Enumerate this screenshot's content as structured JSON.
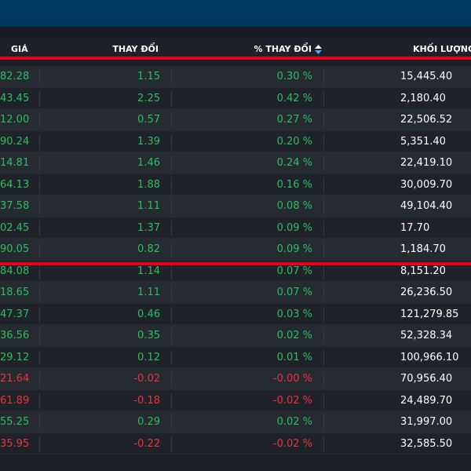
{
  "header": {
    "col_price": "GIÁ",
    "col_change": "THAY ĐỔI",
    "col_pct": "% THAY ĐỔI",
    "col_volume": "KHỐI LƯỢNG"
  },
  "colors": {
    "up": "#2dbe60",
    "down": "#e8343d",
    "highlight_line": "#e8001c",
    "topbar": "#003a63"
  },
  "sort_icon": "sort-up-down-icon",
  "rows": [
    {
      "price": "82.28",
      "change": "1.15",
      "pct": "0.30 %",
      "volume": "15,445.40",
      "dir": "up"
    },
    {
      "price": "43.45",
      "change": "2.25",
      "pct": "0.42 %",
      "volume": "2,180.40",
      "dir": "up"
    },
    {
      "price": "12.00",
      "change": "0.57",
      "pct": "0.27 %",
      "volume": "22,506.52",
      "dir": "up"
    },
    {
      "price": "90.24",
      "change": "1.39",
      "pct": "0.20 %",
      "volume": "5,351.40",
      "dir": "up"
    },
    {
      "price": "14.81",
      "change": "1.46",
      "pct": "0.24 %",
      "volume": "22,419.10",
      "dir": "up"
    },
    {
      "price": "64.13",
      "change": "1.88",
      "pct": "0.16 %",
      "volume": "30,009.70",
      "dir": "up"
    },
    {
      "price": "37.58",
      "change": "1.11",
      "pct": "0.08 %",
      "volume": "49,104.40",
      "dir": "up"
    },
    {
      "price": "02.45",
      "change": "1.37",
      "pct": "0.09 %",
      "volume": "17.70",
      "dir": "up"
    },
    {
      "price": "90.05",
      "change": "0.82",
      "pct": "0.09 %",
      "volume": "1,184.70",
      "dir": "up"
    },
    {
      "price": "84.08",
      "change": "1.14",
      "pct": "0.07 %",
      "volume": "8,151.20",
      "dir": "up"
    },
    {
      "price": "18.65",
      "change": "1.11",
      "pct": "0.07 %",
      "volume": "26,236.50",
      "dir": "up"
    },
    {
      "price": "47.37",
      "change": "0.46",
      "pct": "0.03 %",
      "volume": "121,279.85",
      "dir": "up"
    },
    {
      "price": "36.56",
      "change": "0.35",
      "pct": "0.02 %",
      "volume": "52,328.34",
      "dir": "up"
    },
    {
      "price": "29.12",
      "change": "0.12",
      "pct": "0.01 %",
      "volume": "100,966.10",
      "dir": "up"
    },
    {
      "price": "21.64",
      "change": "-0.02",
      "pct": "-0.00 %",
      "volume": "70,956.40",
      "dir": "down"
    },
    {
      "price": "61.89",
      "change": "-0.18",
      "pct": "-0.02 %",
      "volume": "24,489.70",
      "dir": "down"
    },
    {
      "price": "55.25",
      "change": "0.29",
      "pct": "0.02 %",
      "volume": "31,997.00",
      "dir": "up"
    },
    {
      "price": "35.95",
      "change": "-0.22",
      "pct": "-0.02 %",
      "volume": "32,585.50",
      "dir": "down"
    }
  ]
}
